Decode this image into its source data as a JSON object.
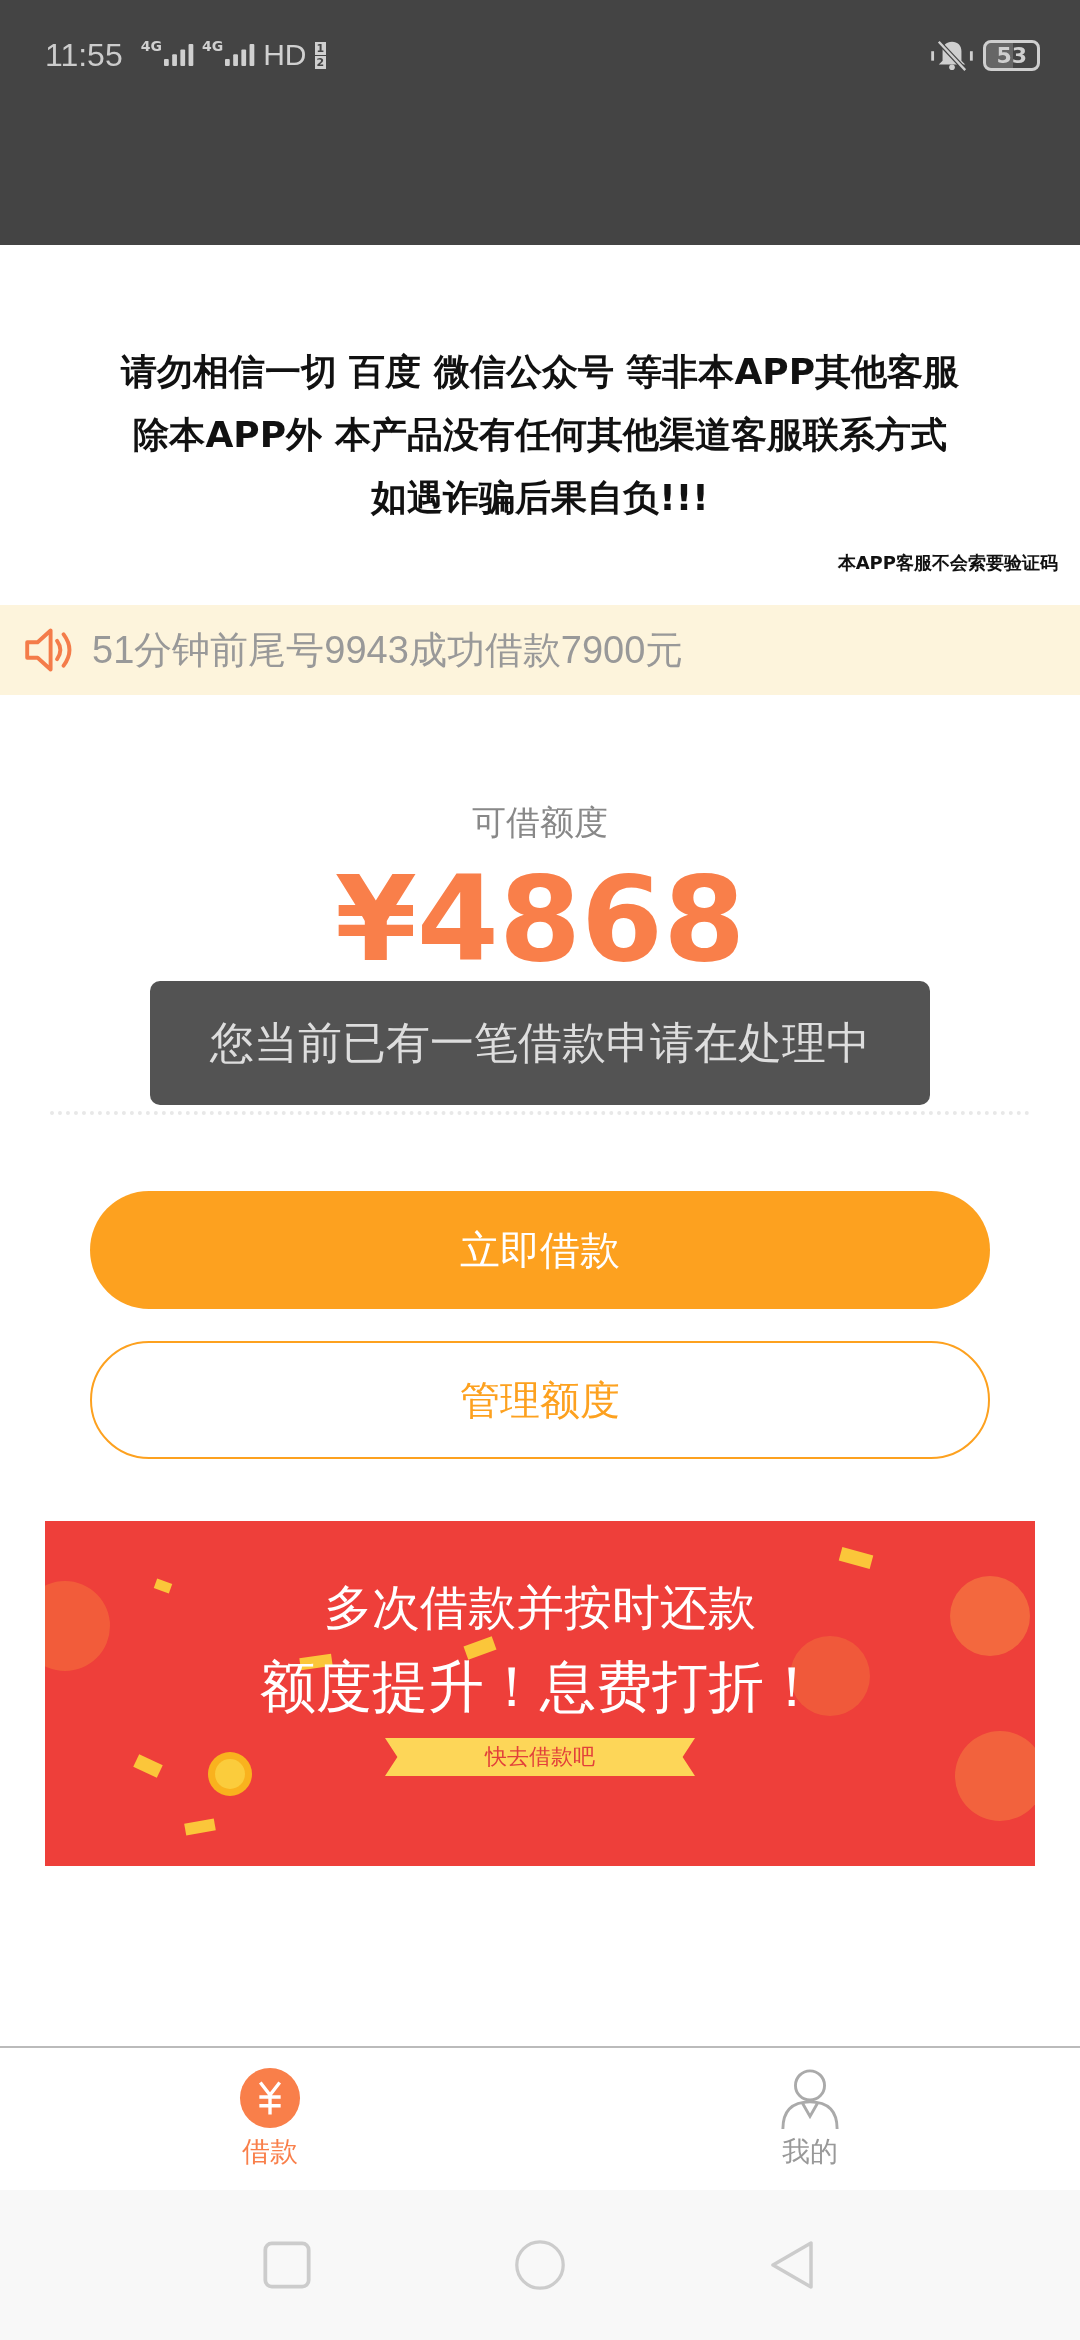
{
  "status_bar": {
    "time": "11:55",
    "networks": [
      "4G",
      "4G"
    ],
    "hd": "HD",
    "sims": [
      "1",
      "2"
    ],
    "battery": "53"
  },
  "notice": {
    "lines": [
      "请勿相信一切 百度 微信公众号 等非本APP其他客服",
      "除本APP外 本产品没有任何其他渠道客服联系方式",
      "如遇诈骗后果自负!!!"
    ],
    "footnote": "本APP客服不会索要验证码"
  },
  "ticker": {
    "text": "51分钟前尾号9943成功借款7900元"
  },
  "credit": {
    "label": "可借额度",
    "amount": "¥4868"
  },
  "toast": {
    "text": "您当前已有一笔借款申请在处理中"
  },
  "buttons": [
    {
      "label": "立即借款",
      "kind": "primary"
    },
    {
      "label": "管理额度",
      "kind": "outline"
    }
  ],
  "banner": {
    "headline": "多次借款并按时还款",
    "subheadline": "额度提升！息费打折！",
    "ribbon": "快去借款吧"
  },
  "tabs": [
    {
      "label": "借款",
      "kind": "yen",
      "selected": true
    },
    {
      "label": "我的",
      "kind": "person",
      "selected": false
    }
  ]
}
